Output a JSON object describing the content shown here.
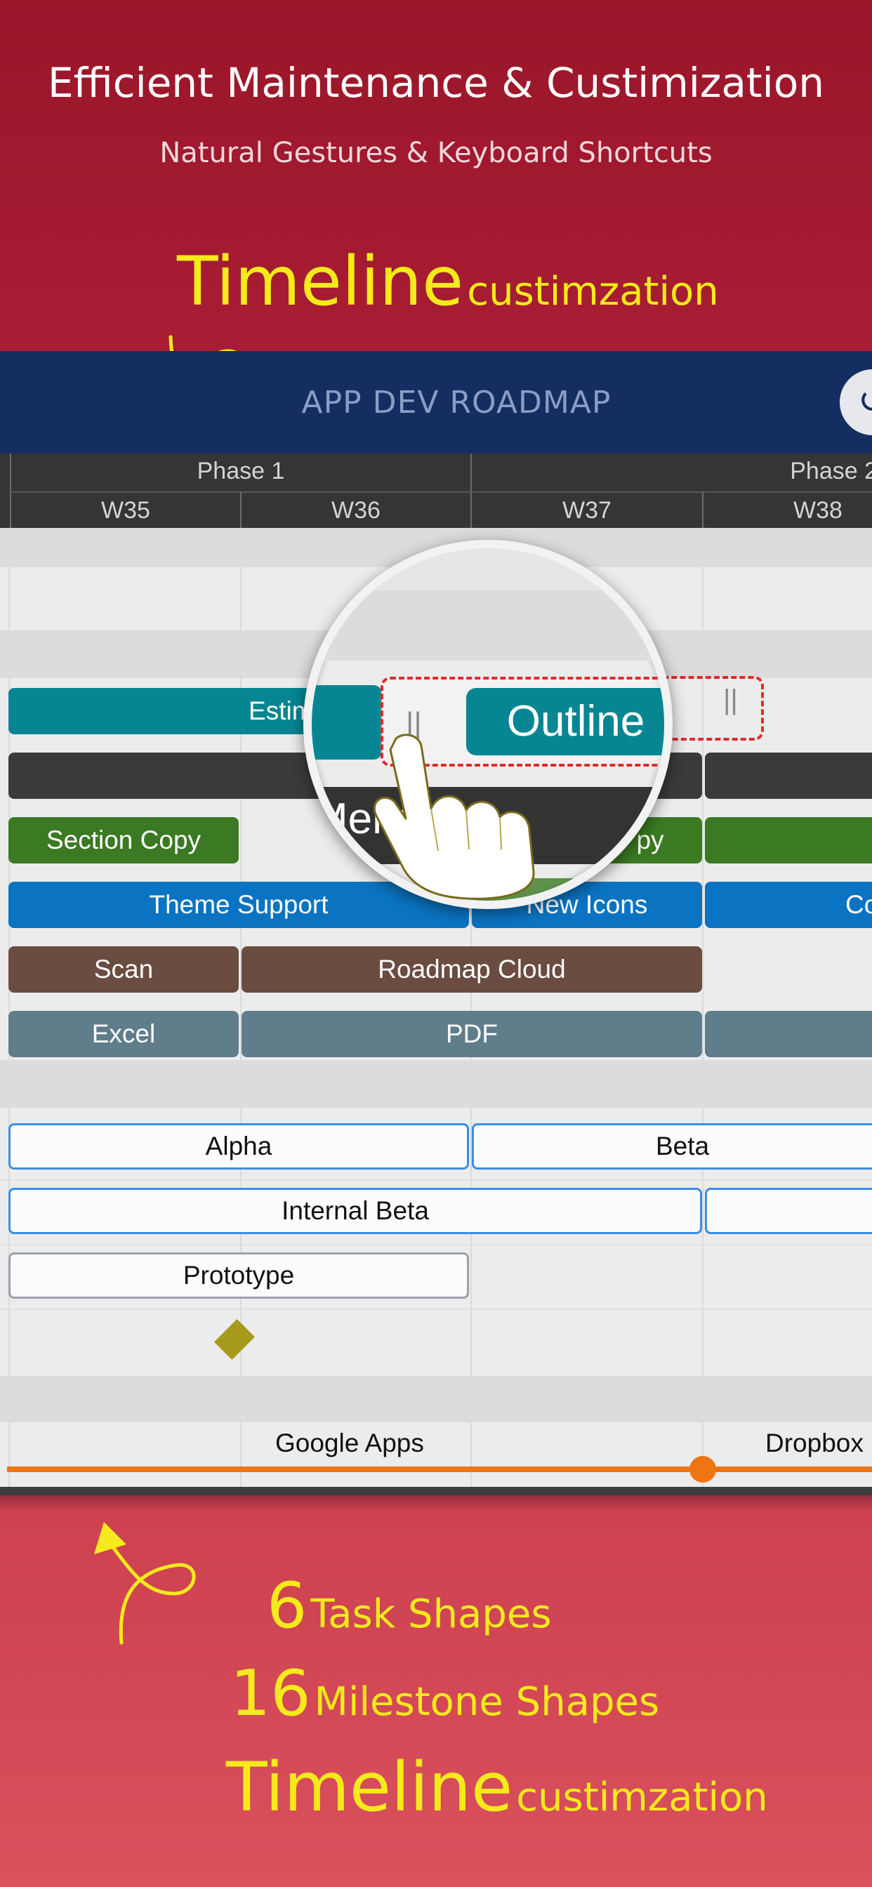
{
  "promo_top": {
    "headline": "Efficient Maintenance & Custimization",
    "subheadline": "Natural Gestures & Keyboard Shortcuts",
    "callout_big": "Timeline",
    "callout_small": "custimzation"
  },
  "app": {
    "title": "APP DEV ROADMAP",
    "share_icon": "share-icon",
    "phases": [
      "Phase 1",
      "Phase 2"
    ],
    "weeks": [
      "W35",
      "W36",
      "W37",
      "W38"
    ],
    "tasks": {
      "estimation": "Estimation Tr",
      "core": "Co",
      "section_copy": "Section Copy",
      "copy_right": "py",
      "theme_support": "Theme Support",
      "new_icons": "New Icons",
      "co_right": "Co",
      "scan": "Scan",
      "roadmap_cloud": "Roadmap Cloud",
      "excel": "Excel",
      "pdf": "PDF"
    },
    "milestones": {
      "alpha": "Alpha",
      "beta": "Beta",
      "internal_beta": "Internal Beta",
      "prototype": "Prototype"
    },
    "timeline": {
      "label_left": "Google Apps",
      "label_right": "Dropbox"
    },
    "magnifier": {
      "outline_label": "Outline",
      "menu_label": "Menu",
      "handle_glyph": "||"
    },
    "colors": {
      "teal": "#068692",
      "dark": "#3a3a3a",
      "green": "#3b7a22",
      "blue": "#0b74c2",
      "brown": "#6b4c41",
      "slate": "#607d8b",
      "timeline": "#ef7412"
    }
  },
  "promo_bottom": {
    "line1_num": "6",
    "line1_text": "Task Shapes",
    "line2_num": "16",
    "line2_text": "Milestone Shapes",
    "line3_big": "Timeline",
    "line3_small": "custimzation"
  }
}
